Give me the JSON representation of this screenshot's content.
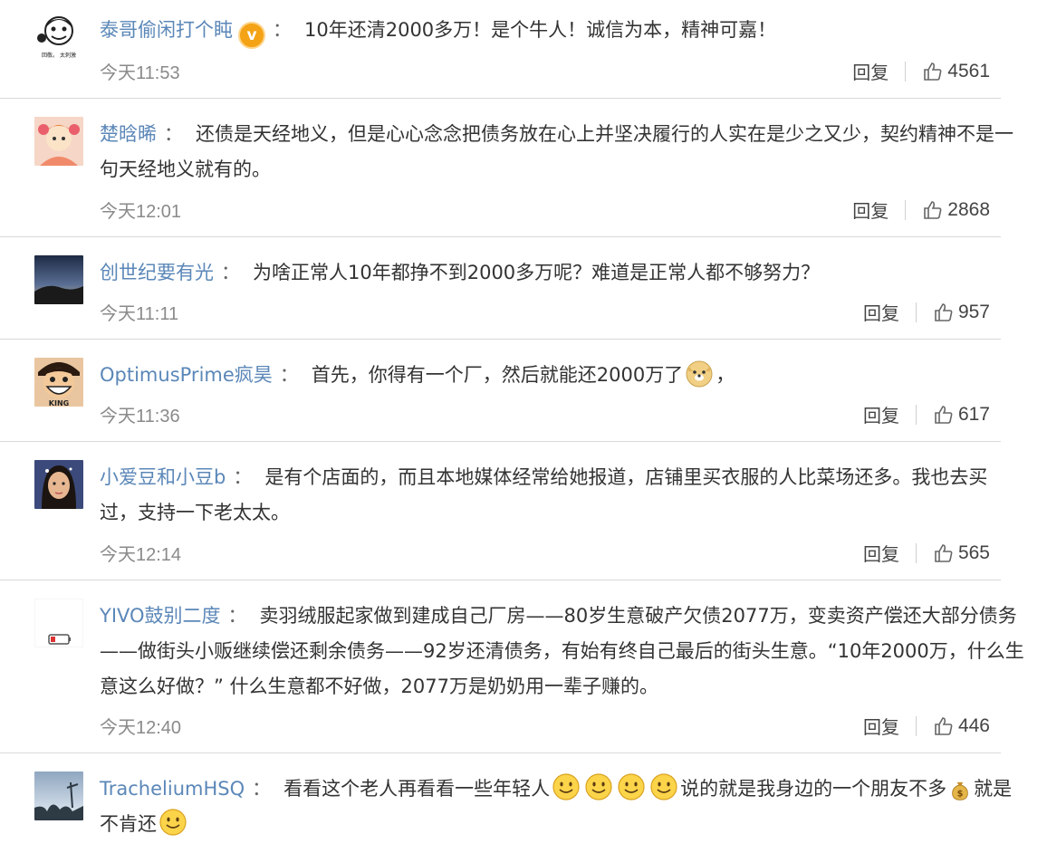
{
  "comments": [
    {
      "username": "泰哥偷闲打个盹",
      "verified": true,
      "text": "10年还清2000多万！是个牛人！诚信为本，精神可嘉！",
      "time": "今天11:53",
      "reply_label": "回复",
      "likes": "4561",
      "avatar_caption": "回敬。 太刺激"
    },
    {
      "username": "楚晗晞",
      "text_line1": "还债是天经地义，但是心心念念把债务放在心上并坚决履行的人实在是少之又少，契约精神不是一",
      "text_line2": "句天经地义就有的。",
      "time": "今天12:01",
      "reply_label": "回复",
      "likes": "2868"
    },
    {
      "username": "创世纪要有光",
      "text": "为啥正常人10年都挣不到2000多万呢？难道是正常人都不够努力？",
      "time": "今天11:11",
      "reply_label": "回复",
      "likes": "957"
    },
    {
      "username": "OptimusPrime疯昊",
      "text": "首先，你得有一个厂，然后就能还2000万了",
      "text_tail": "，",
      "time": "今天11:36",
      "reply_label": "回复",
      "likes": "617",
      "avatar_caption": "KING"
    },
    {
      "username": "小爱豆和小豆b",
      "text_line1": "是有个店面的，而且本地媒体经常给她报道，店铺里买衣服的人比菜场还多。我也去买",
      "text_line2": "过，支持一下老太太。",
      "time": "今天12:14",
      "reply_label": "回复",
      "likes": "565"
    },
    {
      "username": "YIVO鼓别二度",
      "text_line1": "卖羽绒服起家做到建成自己厂房——80岁生意破产欠债2077万，变卖资产偿还大部分债务",
      "text_line2": "——做街头小贩继续偿还剩余债务——92岁还清债务，有始有终自己最后的街头生意。“10年2000万，什么生",
      "text_line3": "意这么好做？” 什么生意都不好做，2077万是奶奶用一辈子赚的。",
      "time": "今天12:40",
      "reply_label": "回复",
      "likes": "446"
    },
    {
      "username": "TracheliumHSQ",
      "text_a": "看看这个老人再看看一些年轻人",
      "text_b": "说的就是我身边的一个朋友不多",
      "text_c": "就是",
      "text_line2": "不肯还"
    }
  ],
  "separator": "：",
  "colors": {
    "username": "#5b87b8",
    "text": "#333333",
    "time": "#8a8a8a",
    "divider": "#d9d9d9",
    "verified_badge": "#f4a316"
  }
}
